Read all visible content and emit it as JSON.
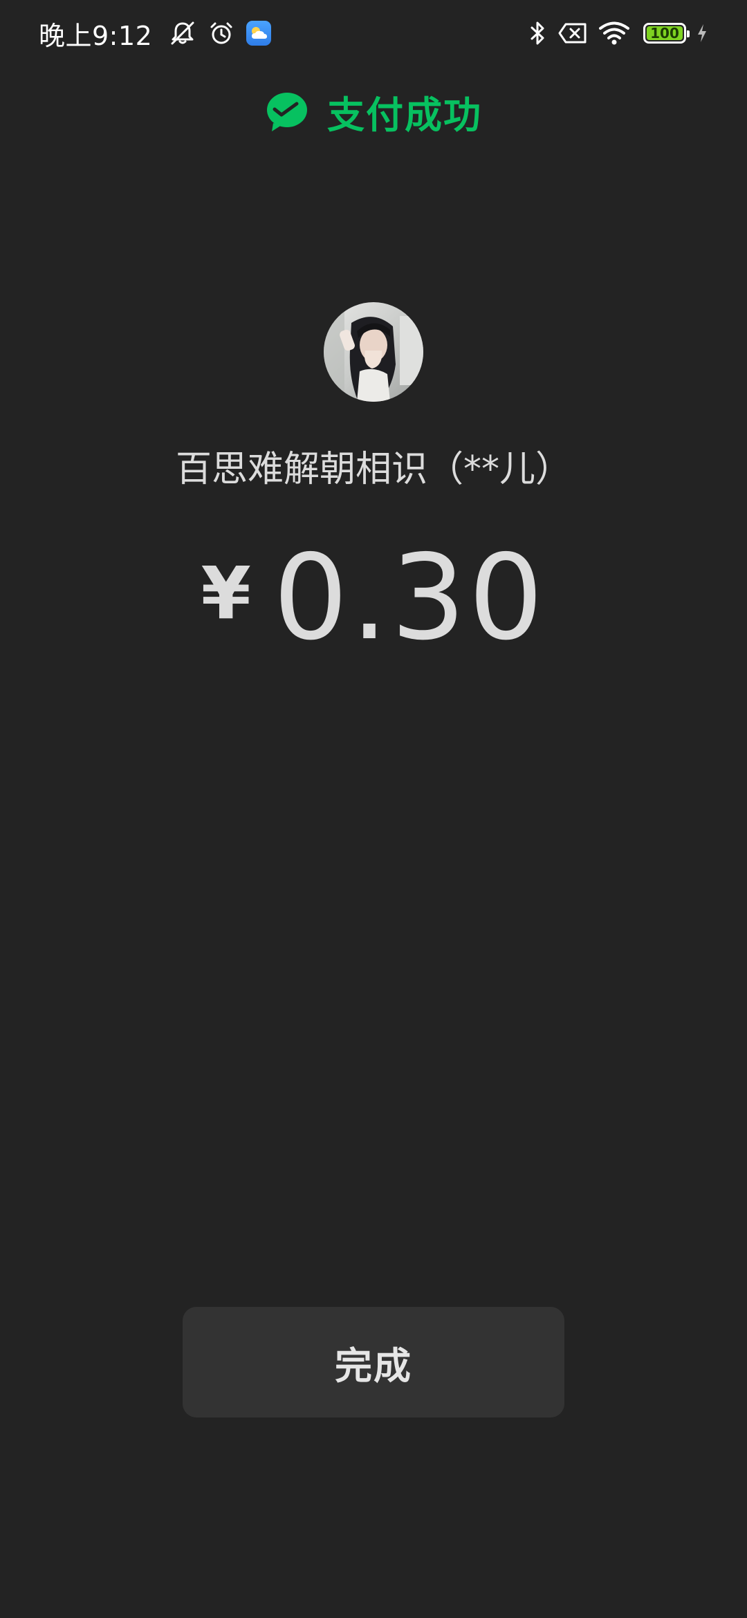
{
  "status_bar": {
    "time": "晚上9:12",
    "icons_left": [
      "mute-icon",
      "alarm-icon",
      "weather-app-icon"
    ],
    "icons_right": [
      "bluetooth-icon",
      "no-sim-icon",
      "wifi-icon",
      "battery-icon",
      "charging-icon"
    ],
    "battery_level": "100",
    "battery_fraction": 1.0
  },
  "header": {
    "icon": "wechat-pay-icon",
    "title": "支付成功",
    "accent_color": "#07c160"
  },
  "payee": {
    "name": "百思难解朝相识（**儿）"
  },
  "payment": {
    "currency": "¥",
    "amount": "0.30"
  },
  "actions": {
    "done_label": "完成"
  }
}
